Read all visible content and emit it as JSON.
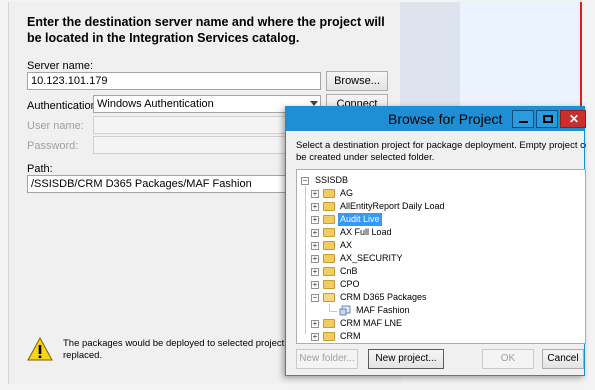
{
  "wizard": {
    "heading": "Enter the destination server name and where the project will be located in the Integration Services catalog.",
    "server_label": "Server name:",
    "server_value": "10.123.101.179",
    "browse_label": "Browse...",
    "auth_label": "Authentication:",
    "auth_value": "Windows Authentication",
    "connect_label": "Connect",
    "user_label": "User name:",
    "password_label": "Password:",
    "path_label": "Path:",
    "path_value": "/SSISDB/CRM D365 Packages/MAF Fashion",
    "warning_text": "The packages would be deployed to selected project. The same n replaced."
  },
  "dialog": {
    "title": "Browse for Project",
    "description_line1": "Select a destination project for package deployment. Empty project coul",
    "description_line2": "be created under selected folder.",
    "tree": {
      "root": "SSISDB",
      "items": [
        {
          "label": "AG",
          "expanded": false
        },
        {
          "label": "AllEntityReport Daily Load",
          "expanded": false
        },
        {
          "label": "Audit Live",
          "expanded": false,
          "selected": true
        },
        {
          "label": "AX Full Load",
          "expanded": false
        },
        {
          "label": "AX",
          "expanded": false
        },
        {
          "label": "AX_SECURITY",
          "expanded": false
        },
        {
          "label": "CnB",
          "expanded": false
        },
        {
          "label": "CPO",
          "expanded": false
        },
        {
          "label": "CRM D365 Packages",
          "expanded": true
        },
        {
          "label": "MAF Fashion",
          "child": true
        },
        {
          "label": "CRM MAF LNE",
          "expanded": false
        },
        {
          "label": "CRM",
          "expanded": false
        }
      ]
    },
    "new_folder_label": "New folder...",
    "new_project_label": "New project...",
    "ok_label": "OK",
    "cancel_label": "Cancel"
  },
  "colors": {
    "title_bar": "#1f8ed4",
    "selection": "#3399ff",
    "close_button": "#c9302c",
    "folder": "#f2cb61"
  },
  "icons": [
    "warning-icon",
    "minimize-icon",
    "maximize-icon",
    "close-icon",
    "folder-icon",
    "project-icon",
    "expand-icon",
    "collapse-icon"
  ]
}
